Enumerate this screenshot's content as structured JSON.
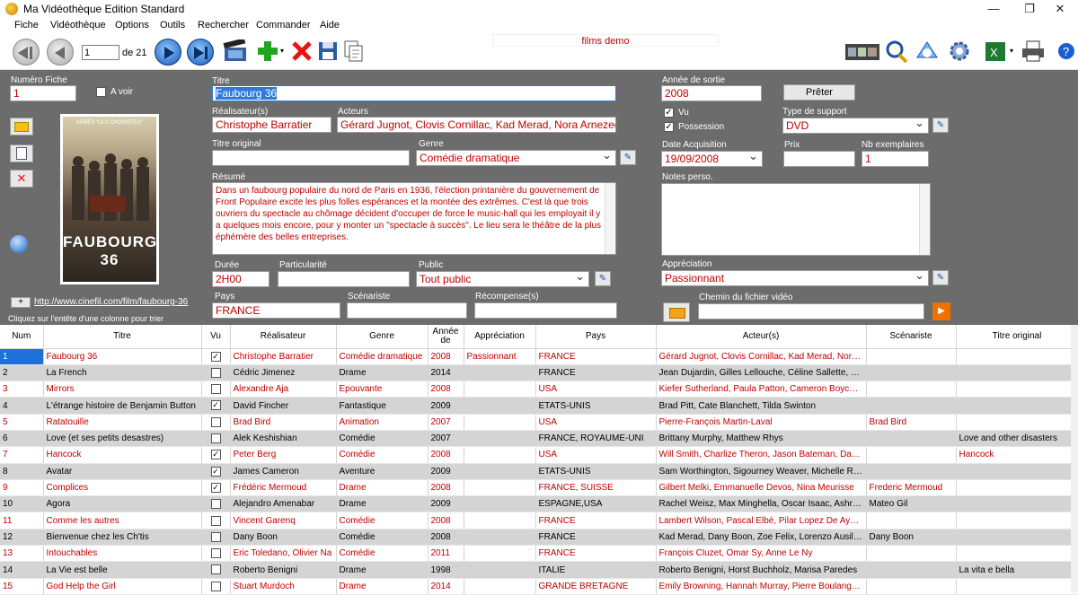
{
  "window": {
    "title": "Ma Vidéothèque Edition Standard"
  },
  "menu": [
    "Fiche",
    "Vidéothèque",
    "Options",
    "Outils",
    "Rechercher",
    "Commander",
    "Aide"
  ],
  "toolbar": {
    "record_value": "1",
    "record_total": "de 21",
    "db_name": "films demo"
  },
  "form": {
    "numero_label": "Numéro Fiche",
    "numero_value": "1",
    "avoir_label": "A voir",
    "titre_label": "Titre",
    "titre_value": "Faubourg 36",
    "realisateur_label": "Réalisateur(s)",
    "realisateur_value": "Christophe Barratier",
    "acteurs_label": "Acteurs",
    "acteurs_value": "Gérard Jugnot, Clovis Cornillac, Kad Merad, Nora Arnezeder, S",
    "titre_original_label": "Titre original",
    "titre_original_value": "",
    "genre_label": "Genre",
    "genre_value": "Comédie dramatique",
    "resume_label": "Résumé",
    "resume_value": "Dans un faubourg populaire du nord de Paris en 1936, l'élection printanière du gouvernement de Front Populaire excite les plus folles espérances et la montée des extrêmes. C'est là que trois ouvriers du spectacle au chômage décident d'occuper de force le music-hall qui les employait il y a quelques mois encore, pour y monter un \"spectacle à succès\". Le lieu sera le théâtre de la plus éphémère des belles entreprises.",
    "duree_label": "Durée",
    "duree_value": "2H00",
    "particularite_label": "Particularité",
    "particularite_value": "",
    "public_label": "Public",
    "public_value": "Tout public",
    "pays_label": "Pays",
    "pays_value": "FRANCE",
    "scenariste_label": "Scénariste",
    "scenariste_value": "",
    "recompense_label": "Récompense(s)",
    "recompense_value": "",
    "annee_label": "Année de sortie",
    "annee_value": "2008",
    "pret_label": "Prêter",
    "vu_label": "Vu",
    "possession_label": "Possession",
    "type_support_label": "Type de support",
    "type_support_value": "DVD",
    "date_acq_label": "Date Acquisition",
    "date_acq_value": "19/09/2008",
    "prix_label": "Prix",
    "prix_value": "",
    "nb_ex_label": "Nb exemplaires",
    "nb_ex_value": "1",
    "notes_label": "Notes perso.",
    "appreciation_label": "Appréciation",
    "appreciation_value": "Passionnant",
    "chemin_label": "Chemin du fichier vidéo",
    "chemin_value": "",
    "url": "http://www.cinefil.com/film/faubourg-36",
    "sort_hint": "Cliquez sur l'entête d'une colonne pour trier",
    "poster_title": "FAUBOURG 36",
    "poster_top": "APRÈS \"LES CHORISTES\""
  },
  "grid": {
    "headers": [
      "Num",
      "Titre",
      "Vu",
      "Réalisateur",
      "Genre",
      "Année de",
      "Appréciation",
      "Pays",
      "Acteur(s)",
      "Scénariste",
      "Titre original"
    ],
    "rows": [
      {
        "num": "1",
        "titre": "Faubourg 36",
        "vu": true,
        "real": "Christophe Barratier",
        "genre": "Comédie dramatique",
        "annee": "2008",
        "appr": "Passionnant",
        "pays": "FRANCE",
        "acteurs": "Gérard Jugnot, Clovis Cornillac, Kad Merad, Nora Arnezeder",
        "scen": "",
        "orig": ""
      },
      {
        "num": "2",
        "titre": "La French",
        "vu": false,
        "real": "Cédric Jimenez",
        "genre": "Drame",
        "annee": "2014",
        "appr": "",
        "pays": "FRANCE",
        "acteurs": "Jean Dujardin, Gilles Lellouche, Céline Sallette, Mélanie",
        "scen": "",
        "orig": ""
      },
      {
        "num": "3",
        "titre": "Mirrors",
        "vu": false,
        "real": "Alexandre Aja",
        "genre": "Epouvante",
        "annee": "2008",
        "appr": "",
        "pays": "USA",
        "acteurs": "Kiefer Sutherland, Paula Patton, Cameron Boyce, Amy",
        "scen": "",
        "orig": ""
      },
      {
        "num": "4",
        "titre": "L'étrange histoire de Benjamin Button",
        "vu": true,
        "real": "David Fincher",
        "genre": "Fantastique",
        "annee": "2009",
        "appr": "",
        "pays": "ETATS-UNIS",
        "acteurs": "Brad Pitt, Cate Blanchett, Tilda Swinton",
        "scen": "",
        "orig": ""
      },
      {
        "num": "5",
        "titre": "Ratatouille",
        "vu": false,
        "real": "Brad Bird",
        "genre": "Animation",
        "annee": "2007",
        "appr": "",
        "pays": "USA",
        "acteurs": "Pierre-François Martin-Laval",
        "scen": "Brad Bird",
        "orig": ""
      },
      {
        "num": "6",
        "titre": "Love (et ses petits desastres)",
        "vu": false,
        "real": "Alek  Keshishian",
        "genre": "Comédie",
        "annee": "2007",
        "appr": "",
        "pays": "FRANCE, ROYAUME-UNI",
        "acteurs": "Brittany Murphy, Matthew Rhys",
        "scen": "",
        "orig": "Love and other disasters"
      },
      {
        "num": "7",
        "titre": "Hancock",
        "vu": true,
        "real": "Peter Berg",
        "genre": "Comédie",
        "annee": "2008",
        "appr": "",
        "pays": "USA",
        "acteurs": "Will Smith, Charlize Theron, Jason Bateman, Daeg Faer",
        "scen": "",
        "orig": "Hancock"
      },
      {
        "num": "8",
        "titre": "Avatar",
        "vu": true,
        "real": "James Cameron",
        "genre": "Aventure",
        "annee": "2009",
        "appr": "",
        "pays": "ETATS-UNIS",
        "acteurs": "Sam Worthington, Sigourney Weaver, Michelle Rodriguez",
        "scen": "",
        "orig": ""
      },
      {
        "num": "9",
        "titre": "Complices",
        "vu": true,
        "real": "Frédéric Mermoud",
        "genre": "Drame",
        "annee": "2008",
        "appr": "",
        "pays": "FRANCE, SUISSE",
        "acteurs": "Gilbert Melki, Emmanuelle Devos, Nina Meurisse",
        "scen": "Frederic Mermoud",
        "orig": ""
      },
      {
        "num": "10",
        "titre": "Agora",
        "vu": false,
        "real": "Alejandro Amenabar",
        "genre": "Drame",
        "annee": "2009",
        "appr": "",
        "pays": "ESPAGNE,USA",
        "acteurs": "Rachel Weisz, Max Minghella, Oscar Isaac, Ashraf Bar",
        "scen": "Mateo Gil",
        "orig": ""
      },
      {
        "num": "11",
        "titre": "Comme les autres",
        "vu": false,
        "real": "Vincent Garenq",
        "genre": "Comédie",
        "annee": "2008",
        "appr": "",
        "pays": "FRANCE",
        "acteurs": "Lambert Wilson, Pascal Elbé, Pilar Lopez De Ayala, An",
        "scen": "",
        "orig": ""
      },
      {
        "num": "12",
        "titre": "Bienvenue chez les Ch'tis",
        "vu": false,
        "real": "Dany Boon",
        "genre": "Comédie",
        "annee": "2008",
        "appr": "",
        "pays": "FRANCE",
        "acteurs": "Kad Merad, Dany Boon, Zoe Felix, Lorenzo Ausilia Fore",
        "scen": "Dany Boon",
        "orig": ""
      },
      {
        "num": "13",
        "titre": "Intouchables",
        "vu": false,
        "real": "Eric Toledano, Olivier Na",
        "genre": "Comédie",
        "annee": "2011",
        "appr": "",
        "pays": "FRANCE",
        "acteurs": "François Cluzet, Omar Sy, Anne Le Ny",
        "scen": "",
        "orig": ""
      },
      {
        "num": "14",
        "titre": "La Vie est belle",
        "vu": false,
        "real": "Roberto Benigni",
        "genre": "Drame",
        "annee": "1998",
        "appr": "",
        "pays": "ITALIE",
        "acteurs": "Roberto Benigni, Horst Buchholz, Marisa Paredes",
        "scen": "",
        "orig": "La vita e bella"
      },
      {
        "num": "15",
        "titre": "God Help the Girl",
        "vu": false,
        "real": "Stuart Murdoch",
        "genre": "Drame",
        "annee": "2014",
        "appr": "",
        "pays": "GRANDE BRETAGNE",
        "acteurs": "Emily Browning, Hannah Murray, Pierre Boulanger, Cora",
        "scen": "",
        "orig": ""
      }
    ]
  },
  "colors": {
    "panel": "#6c6c6c",
    "value_text": "#c00000",
    "accent_blue": "#1c70d8"
  }
}
